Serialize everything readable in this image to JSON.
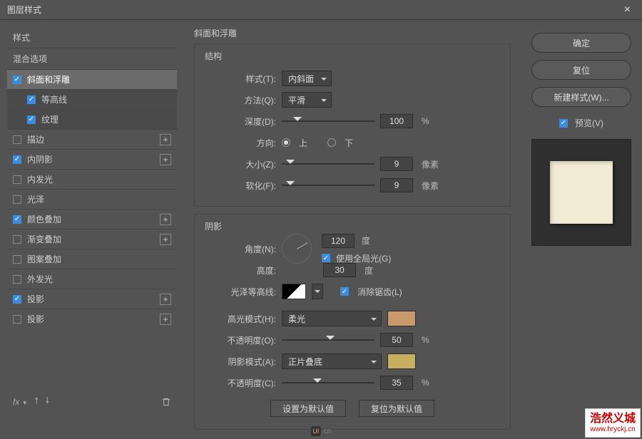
{
  "window": {
    "title": "图层样式",
    "close": "×"
  },
  "sidebar": {
    "styles_label": "样式",
    "blend_label": "混合选项",
    "items": [
      {
        "label": "斜面和浮雕",
        "checked": true,
        "selected": true,
        "plus": false
      },
      {
        "label": "等高线",
        "checked": true,
        "sub": true
      },
      {
        "label": "纹理",
        "checked": true,
        "sub": true
      },
      {
        "label": "描边",
        "checked": false,
        "plus": true
      },
      {
        "label": "内阴影",
        "checked": true,
        "plus": true
      },
      {
        "label": "内发光",
        "checked": false
      },
      {
        "label": "光泽",
        "checked": false
      },
      {
        "label": "颜色叠加",
        "checked": true,
        "plus": true
      },
      {
        "label": "渐变叠加",
        "checked": false,
        "plus": true
      },
      {
        "label": "图案叠加",
        "checked": false
      },
      {
        "label": "外发光",
        "checked": false
      },
      {
        "label": "投影",
        "checked": true,
        "plus": true
      },
      {
        "label": "投影",
        "checked": false,
        "plus": true
      }
    ],
    "fx_label": "fx"
  },
  "center": {
    "title": "斜面和浮雕",
    "structure": {
      "legend": "结构",
      "style_label": "样式(T):",
      "style_value": "内斜面",
      "tech_label": "方法(Q):",
      "tech_value": "平滑",
      "depth_label": "深度(D):",
      "depth_value": "100",
      "depth_unit": "%",
      "dir_label": "方向:",
      "dir_up": "上",
      "dir_down": "下",
      "size_label": "大小(Z):",
      "size_value": "9",
      "size_unit": "像素",
      "soften_label": "软化(F):",
      "soften_value": "9",
      "soften_unit": "像素"
    },
    "shading": {
      "legend": "阴影",
      "angle_label": "角度(N):",
      "angle_value": "120",
      "angle_unit": "度",
      "global_label": "使用全局光(G)",
      "alt_label": "高度:",
      "alt_value": "30",
      "alt_unit": "度",
      "gloss_label": "光泽等高线:",
      "aa_label": "消除锯齿(L)",
      "hl_mode_label": "高光模式(H):",
      "hl_mode_value": "柔光",
      "hl_color": "#c89a6b",
      "hl_op_label": "不透明度(O):",
      "hl_op_value": "50",
      "hl_op_unit": "%",
      "sh_mode_label": "阴影模式(A):",
      "sh_mode_value": "正片叠底",
      "sh_color": "#c8ae5f",
      "sh_op_label": "不透明度(C):",
      "sh_op_value": "35",
      "sh_op_unit": "%"
    },
    "make_default": "设置为默认值",
    "reset_default": "复位为默认值"
  },
  "right": {
    "ok": "确定",
    "reset": "复位",
    "new_style": "新建样式(W)...",
    "preview": "预览(V)"
  },
  "watermark": {
    "line1": "浩然义城",
    "url": "www.hryckj.cn"
  },
  "logo": "cn"
}
